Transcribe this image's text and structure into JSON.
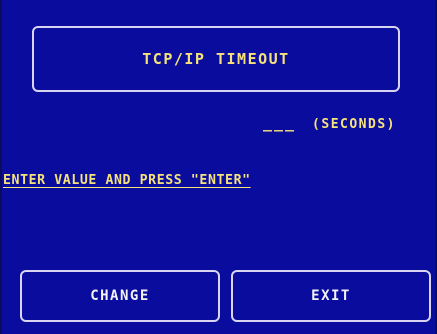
{
  "screen": {
    "title": "TCP/IP TIMEOUT",
    "value_placeholder": "___",
    "units": "(SECONDS)",
    "instruction": "ENTER VALUE AND PRESS \"ENTER\""
  },
  "buttons": {
    "change_label": "CHANGE",
    "exit_label": "EXIT"
  },
  "colors": {
    "background": "#0a0c9e",
    "text_yellow": "#f5e27a",
    "border": "#d8d4f2",
    "button_text": "#f2f2f8"
  }
}
